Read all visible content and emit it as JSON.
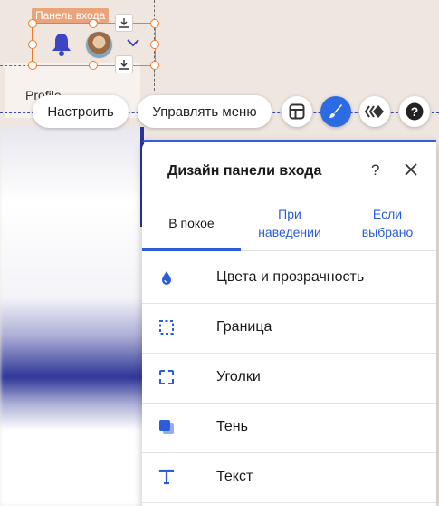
{
  "canvas": {
    "element_tag": "Панель входа",
    "profile_text": "Profile"
  },
  "toolbar": {
    "customize_label": "Настроить",
    "manage_menu_label": "Управлять меню",
    "icons": [
      "layout-icon",
      "paint-brush-icon",
      "animation-icon",
      "help-icon"
    ]
  },
  "design_panel": {
    "title": "Дизайн панели входа",
    "help_label": "?",
    "tabs": [
      {
        "label": "В покое",
        "selected": true
      },
      {
        "label": "При наведении",
        "selected": false
      },
      {
        "label": "Если выбрано",
        "selected": false
      }
    ],
    "options": [
      {
        "label": "Цвета и прозрачность",
        "icon": "droplet-icon"
      },
      {
        "label": "Граница",
        "icon": "border-icon"
      },
      {
        "label": "Уголки",
        "icon": "corners-icon"
      },
      {
        "label": "Тень",
        "icon": "shadow-icon"
      },
      {
        "label": "Текст",
        "icon": "text-icon"
      }
    ]
  },
  "colors": {
    "accent": "#2b5cd9",
    "selection": "#f07c2a",
    "canvas_bg": "#efe6df"
  }
}
